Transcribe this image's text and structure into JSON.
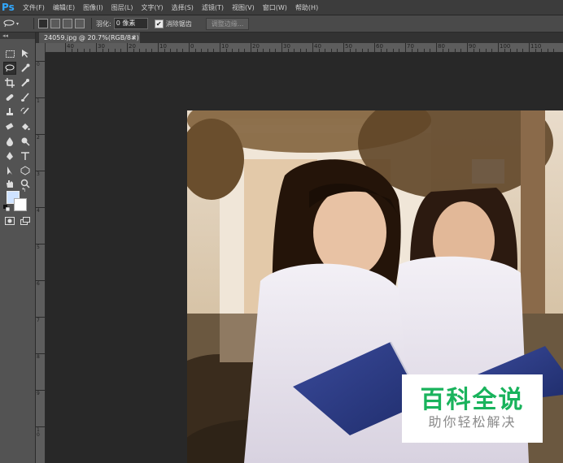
{
  "app": {
    "logo": "Ps"
  },
  "menu": [
    "文件(F)",
    "编辑(E)",
    "图像(I)",
    "图层(L)",
    "文字(Y)",
    "选择(S)",
    "滤镜(T)",
    "视图(V)",
    "窗口(W)",
    "帮助(H)"
  ],
  "options": {
    "feather_label": "羽化:",
    "feather_value": "0 像素",
    "antialias_label": "消除锯齿",
    "antialias_checked": "✔",
    "refine_edge_label": "调整边缘..."
  },
  "toolpanel": {
    "collapse_label": "◂◂"
  },
  "document": {
    "tab_title": "24059.jpg @ 20.7%(RGB/8#) *",
    "close": "×"
  },
  "ruler_top_labels": [
    "40",
    "30",
    "20",
    "10",
    "0",
    "10",
    "20",
    "30",
    "40",
    "50",
    "60",
    "70",
    "80",
    "90",
    "100",
    "110",
    "120",
    "130",
    "140",
    "150",
    "160",
    "170",
    "180",
    "190",
    "200",
    "210",
    "220",
    "230",
    "240"
  ],
  "ruler_left_labels": [
    "0",
    "1",
    "2",
    "3",
    "4",
    "5",
    "6",
    "7",
    "8",
    "9",
    "10"
  ],
  "watermark": {
    "title": "百科全说",
    "subtitle": "助你轻松解决"
  },
  "colors": {
    "accent": "#31a8ff",
    "watermark_green": "#19b35c",
    "foreground_swatch": "#cfe3ff",
    "background_swatch": "#ffffff"
  }
}
